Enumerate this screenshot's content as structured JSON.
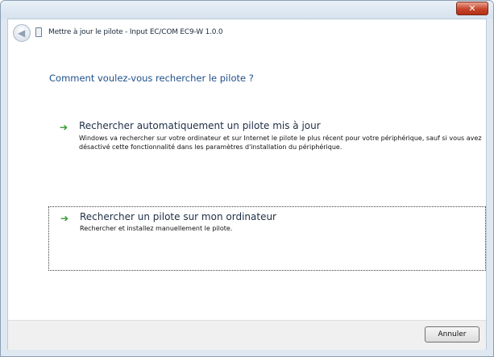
{
  "window": {
    "close_label": "✕"
  },
  "header": {
    "back_glyph": "◀",
    "title": "Mettre à jour le pilote - Input EC/COM EC9-W 1.0.0"
  },
  "main": {
    "question": "Comment voulez-vous rechercher le pilote ?",
    "options": [
      {
        "arrow": "➔",
        "title": "Rechercher automatiquement un pilote mis à jour",
        "description": "Windows va rechercher sur votre ordinateur et sur Internet le pilote le plus récent pour votre périphérique, sauf si vous avez désactivé cette fonctionnalité dans les paramètres d'installation du périphérique."
      },
      {
        "arrow": "➔",
        "title": "Rechercher un pilote sur mon ordinateur",
        "description": "Rechercher et installez manuellement le pilote."
      }
    ]
  },
  "footer": {
    "cancel_label": "Annuler"
  },
  "colors": {
    "accent": "#1e4f8a",
    "arrow": "#2e9a2e",
    "close": "#c7442a"
  }
}
